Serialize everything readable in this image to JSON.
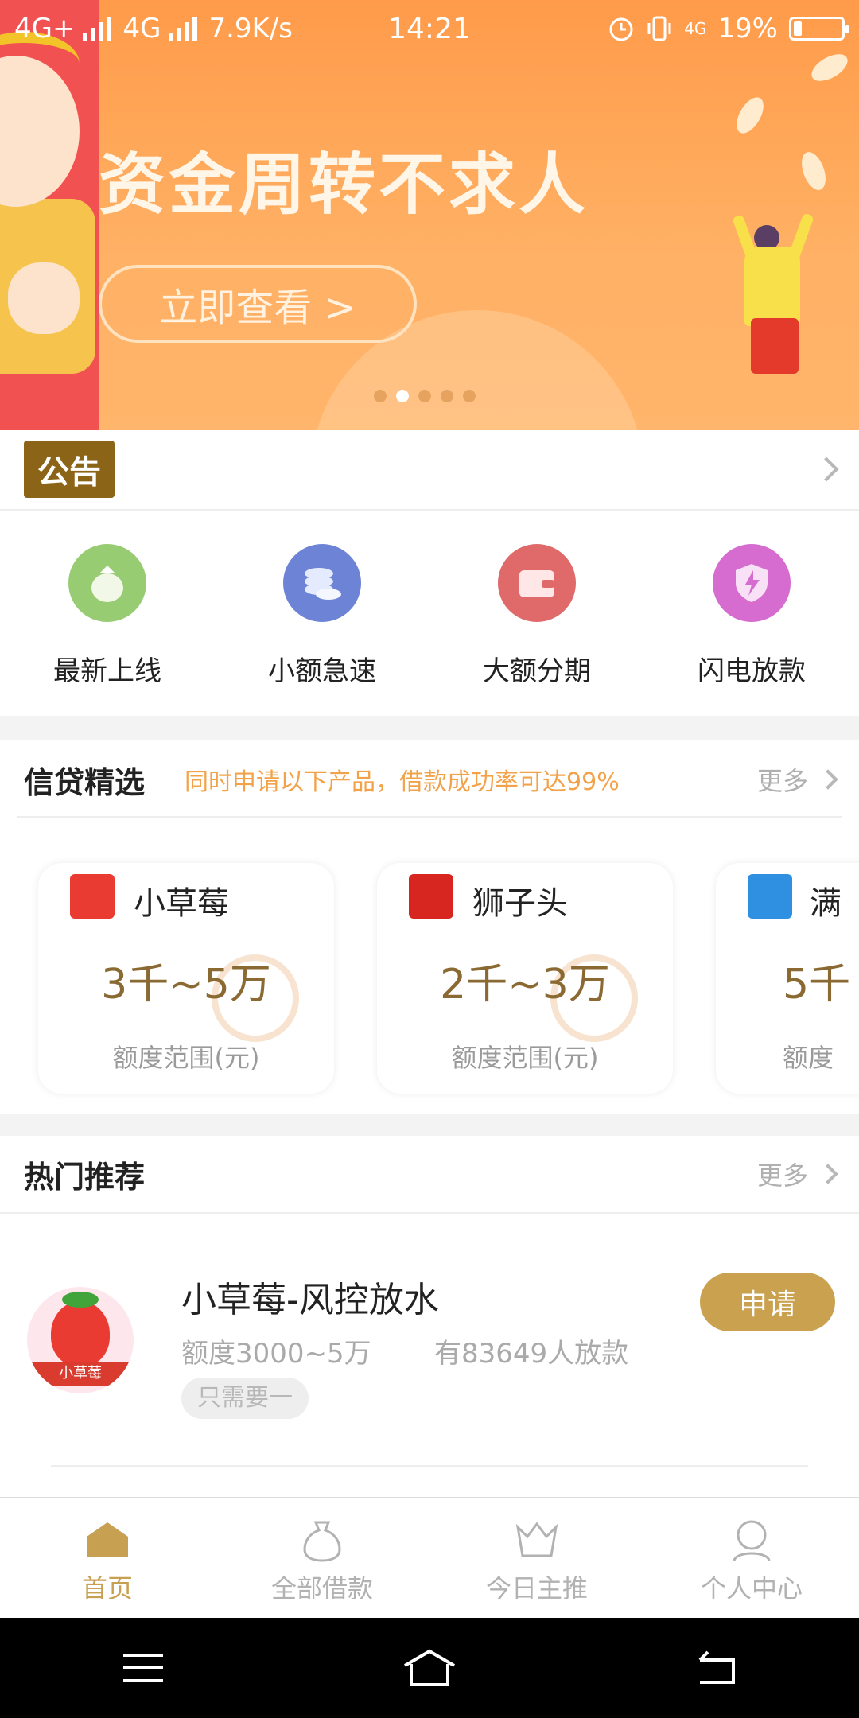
{
  "status_bar": {
    "network1": "4G+",
    "network2": "4G",
    "speed": "7.9K/s",
    "time": "14:21",
    "battery": "19%",
    "network3": "4G"
  },
  "banner": {
    "title": "资金周转不求人",
    "button_label": "立即查看 >",
    "slides": 5,
    "active_slide": 2
  },
  "notice": {
    "label": "公告"
  },
  "categories": [
    {
      "label": "最新上线",
      "color": "#98cc72",
      "icon": "bag-icon"
    },
    {
      "label": "小额急速",
      "color": "#6d84d6",
      "icon": "coins-icon"
    },
    {
      "label": "大额分期",
      "color": "#e06a6a",
      "icon": "wallet-icon"
    },
    {
      "label": "闪电放款",
      "color": "#d66cd0",
      "icon": "lightning-shield-icon"
    }
  ],
  "credit_selection": {
    "title": "信贷精选",
    "subtitle": "同时申请以下产品，借款成功率可达99%",
    "more": "更多",
    "cards": [
      {
        "name": "小草莓",
        "range": "3千~5万",
        "label": "额度范围(元)",
        "logo_color": "#ea3b32"
      },
      {
        "name": "狮子头",
        "range": "2千~3万",
        "label": "额度范围(元)",
        "logo_color": "#d7261f"
      },
      {
        "name": "满",
        "range": "5千",
        "label": "额度",
        "logo_color": "#2f8fe0"
      }
    ]
  },
  "hot": {
    "title": "热门推荐",
    "more": "更多",
    "items": [
      {
        "name": "小草莓-风控放水",
        "limit": "额度3000~5万",
        "count": "有83649人放款",
        "tag": "只需要一",
        "apply": "申请",
        "logo_text": "小草莓"
      }
    ]
  },
  "tabs": [
    {
      "label": "首页",
      "icon": "home-icon",
      "active": true
    },
    {
      "label": "全部借款",
      "icon": "money-bag-icon",
      "active": false
    },
    {
      "label": "今日主推",
      "icon": "crown-icon",
      "active": false
    },
    {
      "label": "个人中心",
      "icon": "user-icon",
      "active": false
    }
  ],
  "accent_color": "#c8a051"
}
